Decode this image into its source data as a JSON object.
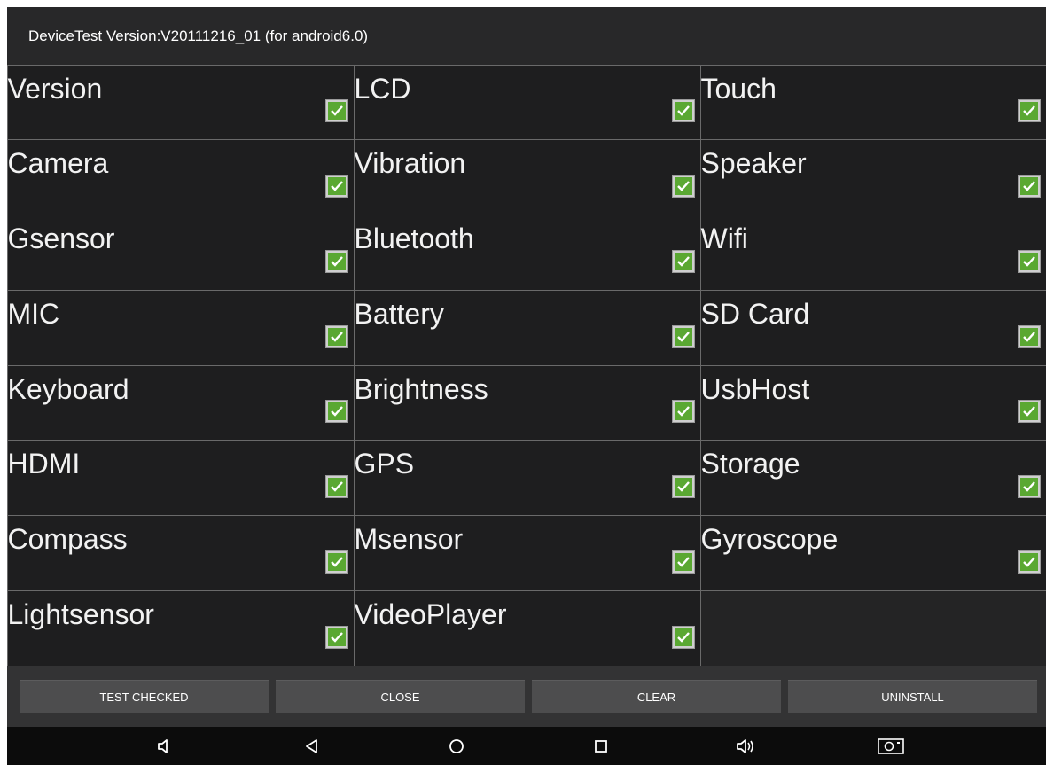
{
  "app": {
    "title": "DeviceTest Version:V20111216_01  (for android6.0)"
  },
  "tests": [
    {
      "label": "Version",
      "checked": true
    },
    {
      "label": "LCD",
      "checked": true
    },
    {
      "label": "Touch",
      "checked": true
    },
    {
      "label": "Camera",
      "checked": true
    },
    {
      "label": "Vibration",
      "checked": true
    },
    {
      "label": "Speaker",
      "checked": true
    },
    {
      "label": "Gsensor",
      "checked": true
    },
    {
      "label": "Bluetooth",
      "checked": true
    },
    {
      "label": "Wifi",
      "checked": true
    },
    {
      "label": "MIC",
      "checked": true
    },
    {
      "label": "Battery",
      "checked": true
    },
    {
      "label": "SD Card",
      "checked": true
    },
    {
      "label": "Keyboard",
      "checked": true
    },
    {
      "label": "Brightness",
      "checked": true
    },
    {
      "label": "UsbHost",
      "checked": true
    },
    {
      "label": "HDMI",
      "checked": true
    },
    {
      "label": "GPS",
      "checked": true
    },
    {
      "label": "Storage",
      "checked": true
    },
    {
      "label": "Compass",
      "checked": true
    },
    {
      "label": "Msensor",
      "checked": true
    },
    {
      "label": "Gyroscope",
      "checked": true
    },
    {
      "label": "Lightsensor",
      "checked": true
    },
    {
      "label": "VideoPlayer",
      "checked": true
    }
  ],
  "buttons": {
    "test_checked": "TEST CHECKED",
    "close": "CLOSE",
    "clear": "CLEAR",
    "uninstall": "UNINSTALL"
  },
  "navbar": {
    "icons": [
      "volume-down-icon",
      "back-icon",
      "home-icon",
      "recents-icon",
      "volume-up-icon",
      "screenshot-icon"
    ]
  },
  "colors": {
    "check_green": "#5aa832",
    "cell_background": "#1e1e1f",
    "button_background": "#4d4d4e"
  }
}
